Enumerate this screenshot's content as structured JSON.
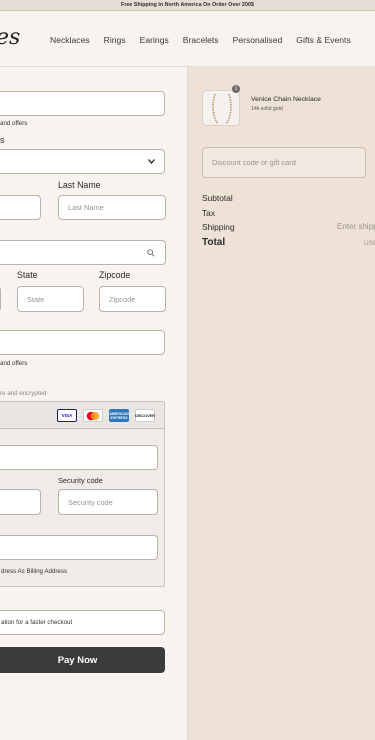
{
  "announcement": "Free Shipping In North America On Order Over 200$",
  "brand_fragment": "es",
  "nav": [
    "Necklaces",
    "Rings",
    "Earings",
    "Bracelets",
    "Personalised",
    "Gifts & Events"
  ],
  "contact": {
    "email_placeholder": "",
    "offers_text": "and offers"
  },
  "delivery": {
    "country_label_fragment": "s",
    "last_name_label": "Last Name",
    "last_name_placeholder": "Last Name",
    "state_label": "State",
    "state_placeholder": "State",
    "zipcode_label": "Zipcode",
    "zipcode_placeholder": "Zipcode",
    "offers_text": "and offers"
  },
  "payment": {
    "secure_text": "re and encrypted",
    "cards": [
      "VISA",
      "MC",
      "AMEX",
      "DISCOVER"
    ],
    "security_label": "Security code",
    "security_placeholder": "Security code",
    "billing_text": "dress As Billing Address"
  },
  "remember_text": "ation for a faster checkout",
  "pay_button": "Pay Now",
  "order": {
    "qty": "1",
    "product_name": "Venice Chain Necklace",
    "product_variant": "14k solid gold",
    "discount_placeholder": "Discount code or gift card",
    "subtotal_label": "Subtotal",
    "tax_label": "Tax",
    "shipping_label": "Shipping",
    "shipping_value": "Enter shipp",
    "total_label": "Total",
    "total_currency": "USD"
  },
  "colors": {
    "accent_dark": "#3b3b3b",
    "summary_bg": "#eee2d7",
    "page_bg": "#f7f3ef"
  }
}
